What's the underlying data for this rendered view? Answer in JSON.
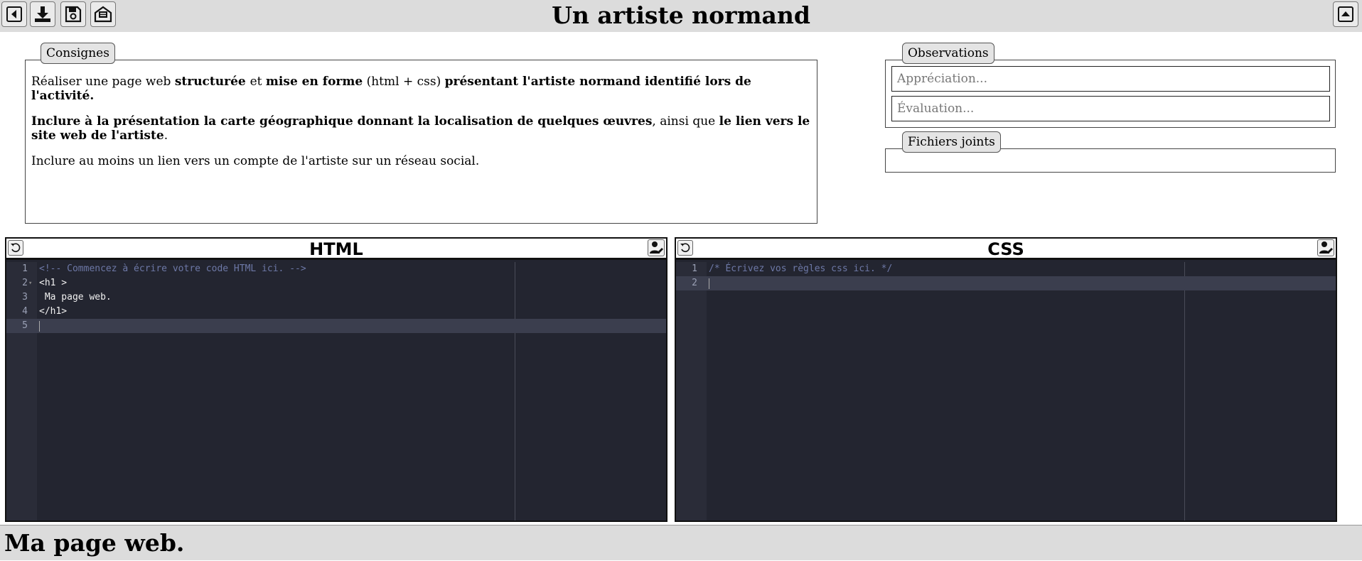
{
  "header": {
    "title": "Un artiste normand",
    "buttons": [
      "back-icon",
      "download-icon",
      "save-icon",
      "submit-icon"
    ],
    "collapse_icon": "collapse-up-icon"
  },
  "consignes": {
    "legend": "Consignes",
    "p1_a": "Réaliser une page web ",
    "p1_b": "structurée ",
    "p1_c": " et ",
    "p1_d": "mise en forme",
    "p1_e": " (html + css) ",
    "p1_f": "présentant l'artiste normand identifié lors de l'activité.",
    "p2_a": "Inclure à la présentation la carte géographique donnant la localisation de quelques œuvres",
    "p2_b": ", ainsi que ",
    "p2_c": "le lien vers le site web de l'artiste",
    "p2_d": ".",
    "p3": "Inclure au moins un lien vers un compte de l'artiste sur un réseau social."
  },
  "observations": {
    "legend": "Observations",
    "appreciation_placeholder": "Appréciation...",
    "evaluation_placeholder": "Évaluation..."
  },
  "fichiers": {
    "legend": "Fichiers joints"
  },
  "html_editor": {
    "title": "HTML",
    "lines": [
      {
        "n": "1",
        "text": "<!-- Commencez à écrire votre code HTML ici. -->",
        "comment": true
      },
      {
        "n": "2",
        "text": "<h1 >"
      },
      {
        "n": "3",
        "text": " Ma page web."
      },
      {
        "n": "4",
        "text": "</h1>"
      },
      {
        "n": "5",
        "text": ""
      }
    ]
  },
  "css_editor": {
    "title": "CSS",
    "lines": [
      {
        "n": "1",
        "text": "/* Écrivez vos règles css ici. */",
        "comment": true
      },
      {
        "n": "2",
        "text": ""
      }
    ]
  },
  "preview": {
    "h1": "Ma page web."
  }
}
